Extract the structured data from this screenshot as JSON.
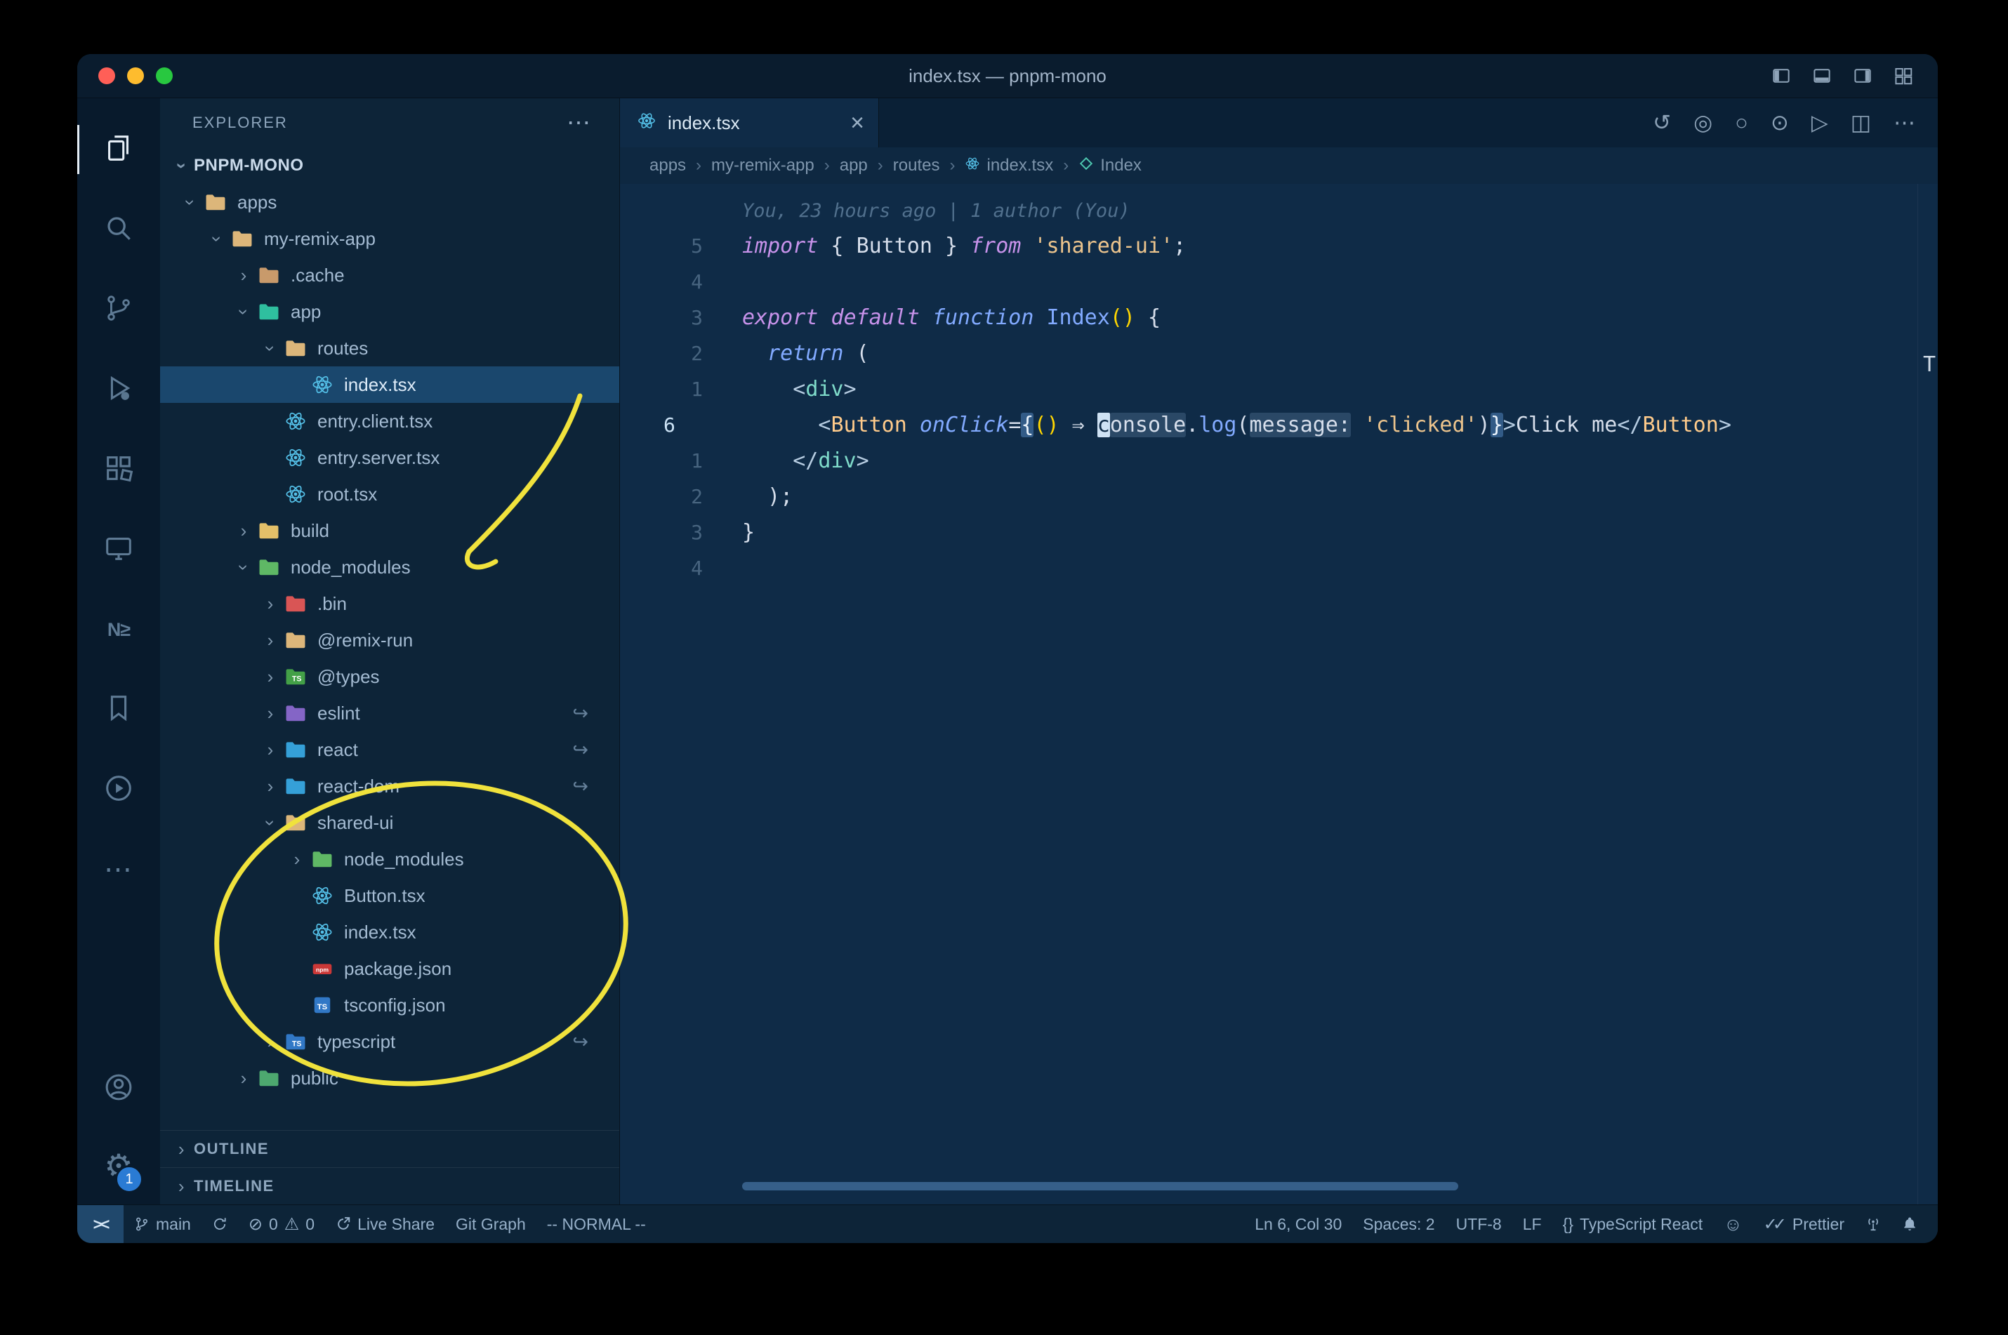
{
  "window": {
    "title": "index.tsx — pnpm-mono"
  },
  "activity_bar": {
    "nx_label": "N≥",
    "more_label": "⋯",
    "settings_badge": "1"
  },
  "explorer": {
    "header": "EXPLORER",
    "header_actions": "⋯",
    "root_label": "PNPM-MONO",
    "sections": {
      "outline": "OUTLINE",
      "timeline": "TIMELINE"
    },
    "tree": [
      {
        "label": "apps",
        "depth": 0,
        "icon": "folder",
        "color": "#dcb67a",
        "chevron": "open"
      },
      {
        "label": "my-remix-app",
        "depth": 1,
        "icon": "folder",
        "color": "#dcb67a",
        "chevron": "open"
      },
      {
        "label": ".cache",
        "depth": 2,
        "icon": "folder",
        "color": "#c89a6b",
        "chevron": "closed"
      },
      {
        "label": "app",
        "depth": 2,
        "icon": "folder",
        "color": "#2fbf9f",
        "chevron": "open"
      },
      {
        "label": "routes",
        "depth": 3,
        "icon": "folder",
        "color": "#dcb67a",
        "chevron": "open"
      },
      {
        "label": "index.tsx",
        "depth": 4,
        "icon": "react",
        "selected": true
      },
      {
        "label": "entry.client.tsx",
        "depth": 3,
        "icon": "react"
      },
      {
        "label": "entry.server.tsx",
        "depth": 3,
        "icon": "react"
      },
      {
        "label": "root.tsx",
        "depth": 3,
        "icon": "react"
      },
      {
        "label": "build",
        "depth": 2,
        "icon": "folder",
        "color": "#e3c069",
        "chevron": "closed"
      },
      {
        "label": "node_modules",
        "depth": 2,
        "icon": "folder",
        "color": "#5fb865",
        "chevron": "open"
      },
      {
        "label": ".bin",
        "depth": 3,
        "icon": "folder",
        "color": "#d95555",
        "chevron": "closed"
      },
      {
        "label": "@remix-run",
        "depth": 3,
        "icon": "folder",
        "color": "#dcb67a",
        "chevron": "closed"
      },
      {
        "label": "@types",
        "depth": 3,
        "icon": "folder",
        "color": "#43a047",
        "chevron": "closed",
        "badge": "TS"
      },
      {
        "label": "eslint",
        "depth": 3,
        "icon": "folder",
        "color": "#8465c6",
        "chevron": "closed",
        "symlink": true
      },
      {
        "label": "react",
        "depth": 3,
        "icon": "folder",
        "color": "#35a0d8",
        "chevron": "closed",
        "symlink": true
      },
      {
        "label": "react-dom",
        "depth": 3,
        "icon": "folder",
        "color": "#35a0d8",
        "chevron": "closed",
        "symlink": true
      },
      {
        "label": "shared-ui",
        "depth": 3,
        "icon": "folder",
        "color": "#dcb67a",
        "chevron": "open"
      },
      {
        "label": "node_modules",
        "depth": 4,
        "icon": "folder",
        "color": "#5fb865",
        "chevron": "closed"
      },
      {
        "label": "Button.tsx",
        "depth": 4,
        "icon": "react"
      },
      {
        "label": "index.tsx",
        "depth": 4,
        "icon": "react"
      },
      {
        "label": "package.json",
        "depth": 4,
        "icon": "npm"
      },
      {
        "label": "tsconfig.json",
        "depth": 4,
        "icon": "ts"
      },
      {
        "label": "typescript",
        "depth": 3,
        "icon": "folder",
        "color": "#3178c6",
        "chevron": "closed",
        "symlink": true,
        "badge": "TS"
      },
      {
        "label": "public",
        "depth": 2,
        "icon": "folder",
        "color": "#4da86f",
        "chevron": "closed"
      }
    ]
  },
  "editor_group": {
    "tab": {
      "label": "index.tsx",
      "close": "×"
    },
    "actions": [
      {
        "name": "timeline-history-icon",
        "glyph": "↺"
      },
      {
        "name": "gitlens-prev-change-icon",
        "glyph": "◎"
      },
      {
        "name": "gitlens-changes-icon",
        "glyph": "○"
      },
      {
        "name": "gitlens-next-change-icon",
        "glyph": "⊙"
      },
      {
        "name": "run-code-icon",
        "glyph": "▷"
      },
      {
        "name": "split-editor-icon",
        "glyph": "◫"
      },
      {
        "name": "more-actions-icon",
        "glyph": "⋯"
      }
    ]
  },
  "breadcrumbs": [
    {
      "label": "apps"
    },
    {
      "label": "my-remix-app"
    },
    {
      "label": "app"
    },
    {
      "label": "routes"
    },
    {
      "label": "index.tsx",
      "icon": "react"
    },
    {
      "label": "Index",
      "icon": "symbol"
    }
  ],
  "editor": {
    "blame": "You, 23 hours ago | 1 author (You)",
    "lines": [
      {
        "num": "",
        "blame": true,
        "tokens": [
          {
            "t": "You, 23 hours ago | 1 author (You)",
            "s": "blame"
          }
        ]
      },
      {
        "num": "5",
        "tokens": [
          {
            "t": "import",
            "s": "kw"
          },
          {
            "t": " { ",
            "s": "txt"
          },
          {
            "t": "Button",
            "s": "txt"
          },
          {
            "t": " } ",
            "s": "txt"
          },
          {
            "t": "from",
            "s": "kw"
          },
          {
            "t": " ",
            "s": "txt"
          },
          {
            "t": "'shared-ui'",
            "s": "str"
          },
          {
            "t": ";",
            "s": "txt"
          }
        ]
      },
      {
        "num": "4",
        "tokens": []
      },
      {
        "num": "3",
        "tokens": [
          {
            "t": "export",
            "s": "kw"
          },
          {
            "t": " ",
            "s": "txt"
          },
          {
            "t": "default",
            "s": "kw"
          },
          {
            "t": " ",
            "s": "txt"
          },
          {
            "t": "function",
            "s": "ctl"
          },
          {
            "t": " ",
            "s": "txt"
          },
          {
            "t": "Index",
            "s": "fn"
          },
          {
            "t": "()",
            "s": "gold"
          },
          {
            "t": " {",
            "s": "txt"
          }
        ]
      },
      {
        "num": "2",
        "tokens": [
          {
            "t": "  ",
            "s": "txt"
          },
          {
            "t": "return",
            "s": "ctl"
          },
          {
            "t": " (",
            "s": "txt"
          }
        ]
      },
      {
        "num": "1",
        "tokens": [
          {
            "t": "    ",
            "s": "txt"
          },
          {
            "t": "<",
            "s": "pun"
          },
          {
            "t": "div",
            "s": "tag"
          },
          {
            "t": ">",
            "s": "pun"
          }
        ]
      },
      {
        "num": "6",
        "active": true,
        "tokens": [
          {
            "t": "      ",
            "s": "txt"
          },
          {
            "t": "<",
            "s": "pun"
          },
          {
            "t": "Button",
            "s": "comp"
          },
          {
            "t": " ",
            "s": "txt"
          },
          {
            "t": "onClick",
            "s": "attr"
          },
          {
            "t": "=",
            "s": "txt"
          },
          {
            "t": "{",
            "s": "brc"
          },
          {
            "t": "()",
            "s": "gold"
          },
          {
            "t": " ",
            "s": "txt"
          },
          {
            "t": "⇒",
            "s": "txt"
          },
          {
            "t": " ",
            "s": "txt"
          },
          {
            "t": "c",
            "s": "cursor"
          },
          {
            "t": "onsole",
            "s": "chip"
          },
          {
            "t": ".",
            "s": "txt"
          },
          {
            "t": "log",
            "s": "fn"
          },
          {
            "t": "(",
            "s": "txt"
          },
          {
            "t": "message:",
            "s": "chip"
          },
          {
            "t": " ",
            "s": "txt"
          },
          {
            "t": "'clicked'",
            "s": "str"
          },
          {
            "t": ")",
            "s": "txt"
          },
          {
            "t": "}",
            "s": "brc"
          },
          {
            "t": ">",
            "s": "pun"
          },
          {
            "t": "Click me",
            "s": "txt"
          },
          {
            "t": "</",
            "s": "pun"
          },
          {
            "t": "Button",
            "s": "comp"
          },
          {
            "t": ">",
            "s": "pun"
          }
        ]
      },
      {
        "num": "1",
        "tokens": [
          {
            "t": "    ",
            "s": "txt"
          },
          {
            "t": "</",
            "s": "pun"
          },
          {
            "t": "div",
            "s": "tag"
          },
          {
            "t": ">",
            "s": "pun"
          }
        ]
      },
      {
        "num": "2",
        "tokens": [
          {
            "t": "  );",
            "s": "txt"
          }
        ]
      },
      {
        "num": "3",
        "tokens": [
          {
            "t": "}",
            "s": "txt"
          }
        ]
      },
      {
        "num": "4",
        "tokens": []
      }
    ]
  },
  "status_bar": {
    "left": [
      {
        "name": "remote-indicator",
        "icon": "remote"
      },
      {
        "name": "git-branch",
        "icon": "branch",
        "label": "main"
      },
      {
        "name": "sync-changes",
        "icon": "sync"
      },
      {
        "name": "problems",
        "parts": [
          {
            "icon": "error",
            "label": "0"
          },
          {
            "icon": "warning",
            "label": "0"
          }
        ]
      },
      {
        "name": "live-share",
        "icon": "liveshare",
        "label": "Live Share"
      },
      {
        "name": "git-graph",
        "label": "Git Graph"
      },
      {
        "name": "vim-mode",
        "label": "-- NORMAL --"
      }
    ],
    "right": [
      {
        "name": "cursor-position",
        "label": "Ln 6, Col 30"
      },
      {
        "name": "indentation",
        "label": "Spaces: 2"
      },
      {
        "name": "encoding",
        "label": "UTF-8"
      },
      {
        "name": "eol",
        "label": "LF"
      },
      {
        "name": "language-mode",
        "icon": "braces",
        "label": "TypeScript React"
      },
      {
        "name": "feedback-smiley",
        "icon": "smiley"
      },
      {
        "name": "prettier",
        "icon": "checks",
        "label": "Prettier"
      },
      {
        "name": "broadcast",
        "icon": "tower"
      },
      {
        "name": "notifications",
        "icon": "bell"
      }
    ]
  },
  "artifacts": {
    "minimap_text": "T"
  },
  "annotations": {
    "color": "#f0e23c"
  }
}
